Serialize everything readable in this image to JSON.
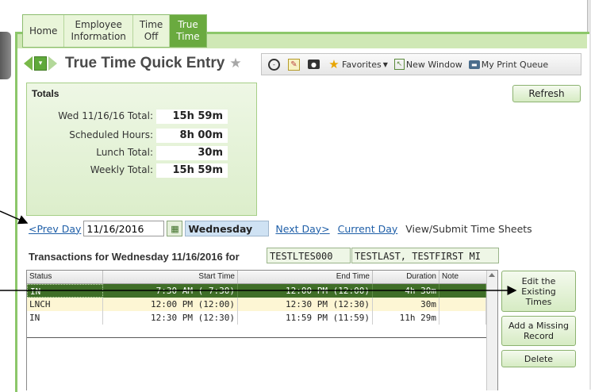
{
  "tabs": [
    {
      "line1": "Home",
      "line2": ""
    },
    {
      "line1": "Employee",
      "line2": "Information"
    },
    {
      "line1": "Time",
      "line2": "Off"
    },
    {
      "line1": "True",
      "line2": "Time"
    }
  ],
  "page_title": "True Time Quick Entry",
  "toolbar": {
    "favorites": "Favorites",
    "new_window": "New Window",
    "print_queue": "My Print Queue"
  },
  "totals": {
    "heading": "Totals",
    "rows": [
      {
        "label": "Wed 11/16/16 Total:",
        "value": "15h 59m"
      },
      {
        "label": "Scheduled Hours:",
        "value": "8h 00m"
      },
      {
        "label": "Lunch Total:",
        "value": "30m"
      },
      {
        "label": "Weekly Total:",
        "value": "15h 59m"
      }
    ]
  },
  "refresh_label": "Refresh",
  "day_nav": {
    "prev_day": "<Prev Day",
    "date_value": "11/16/2016",
    "day_name": "Wednesday",
    "next_day": "Next Day>",
    "current_day": "Current Day",
    "view_submit": "View/Submit Time Sheets"
  },
  "transactions": {
    "title": "Transactions for Wednesday 11/16/2016 for",
    "employee_id": "TESTLTES000",
    "employee_name": "TESTLAST, TESTFIRST MI",
    "columns": [
      "Status",
      "Start Time",
      "End Time",
      "Duration",
      "Note"
    ],
    "rows": [
      {
        "status": "IN",
        "start": "7:30 AM ( 7:30)",
        "end": "12:00 PM (12:00)",
        "duration": "4h 30m",
        "note": ""
      },
      {
        "status": "LNCH",
        "start": "12:00 PM (12:00)",
        "end": "12:30 PM (12:30)",
        "duration": "30m",
        "note": ""
      },
      {
        "status": "IN",
        "start": "12:30 PM (12:30)",
        "end": "11:59 PM (11:59)",
        "duration": "11h 29m",
        "note": ""
      }
    ]
  },
  "side_buttons": {
    "edit_existing": "Edit the Existing Times",
    "add_missing": "Add a Missing Record",
    "delete": "Delete"
  }
}
